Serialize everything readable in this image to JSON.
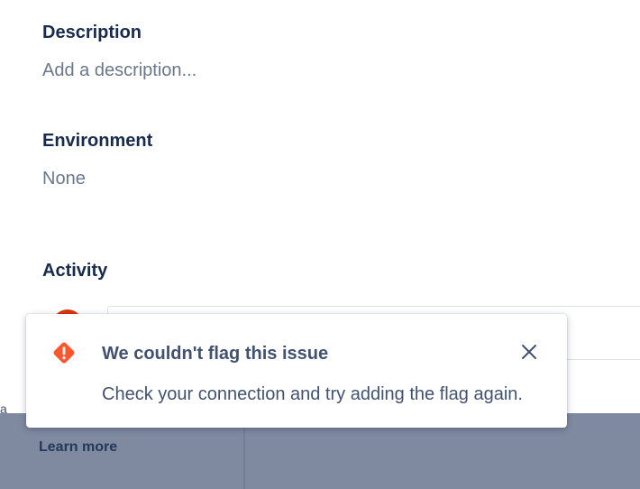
{
  "issue": {
    "description": {
      "heading": "Description",
      "placeholder": "Add a description..."
    },
    "environment": {
      "heading": "Environment",
      "value": "None"
    },
    "activity": {
      "heading": "Activity"
    }
  },
  "background": {
    "learn_more": "Learn more",
    "edge_text": "a"
  },
  "flag": {
    "icon": "error-icon",
    "title": "We couldn't flag this issue",
    "description": "Check your connection and try adding the flag again.",
    "close_icon": "close-icon",
    "icon_color": "#ff5630"
  }
}
